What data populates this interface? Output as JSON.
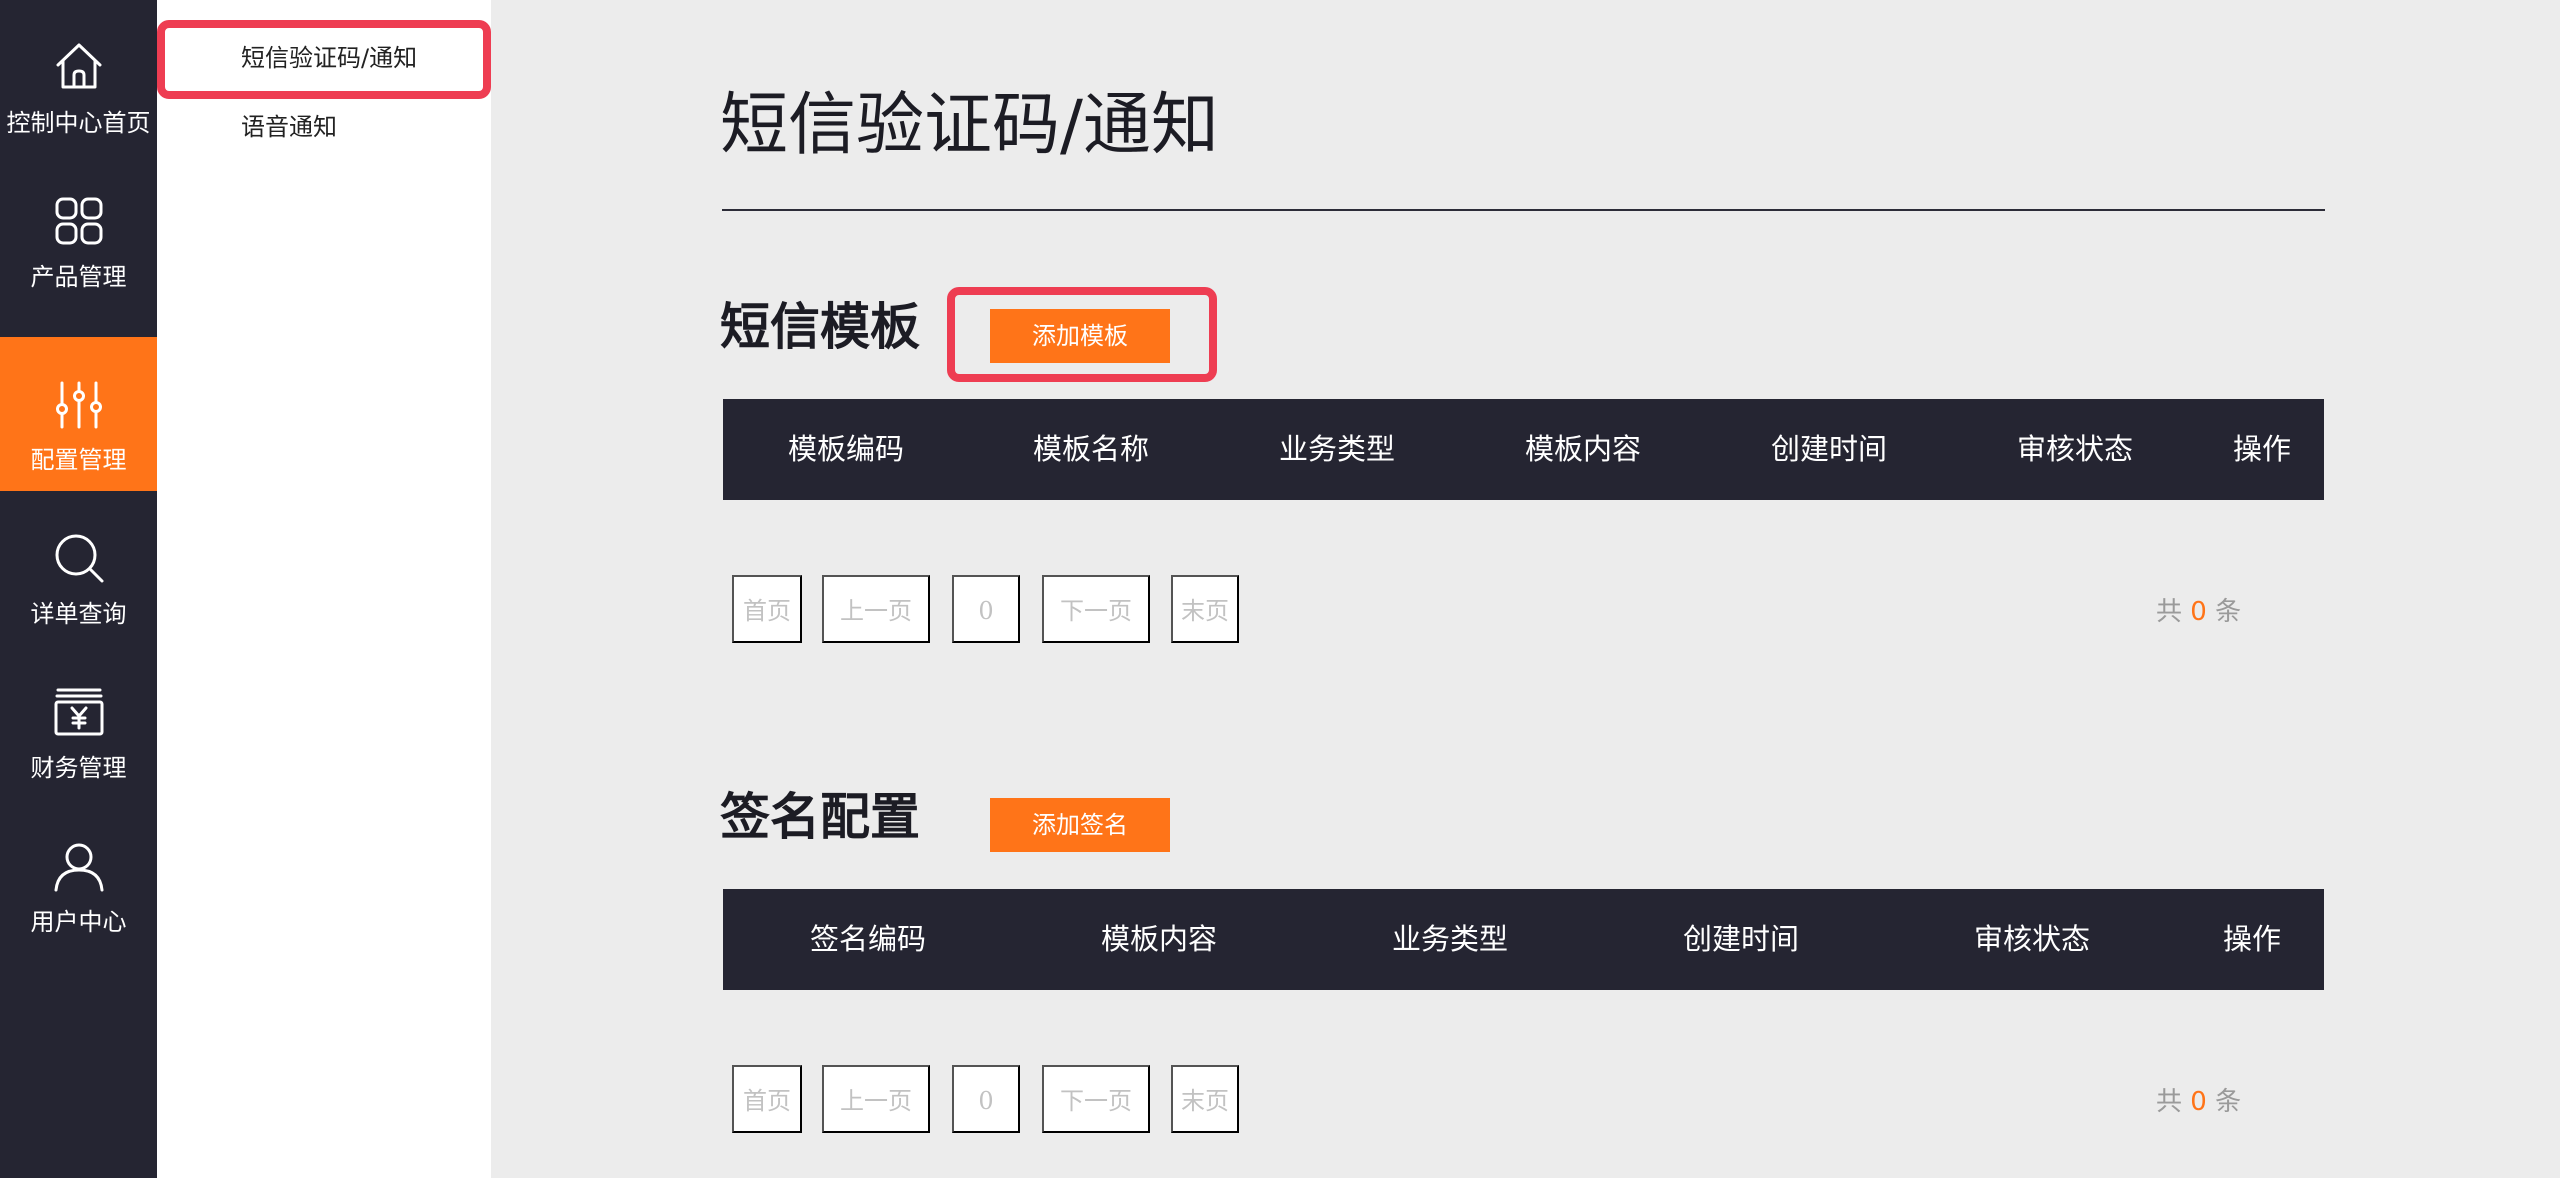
{
  "nav": {
    "items": [
      {
        "label": "控制中心首页",
        "icon": "home-icon"
      },
      {
        "label": "产品管理",
        "icon": "grid-icon"
      },
      {
        "label": "配置管理",
        "icon": "sliders-icon",
        "active": true
      },
      {
        "label": "详单查询",
        "icon": "search-icon"
      },
      {
        "label": "财务管理",
        "icon": "yen-box-icon"
      },
      {
        "label": "用户中心",
        "icon": "user-icon"
      }
    ]
  },
  "submenu": {
    "items": [
      {
        "label": "短信验证码/通知",
        "selected": true
      },
      {
        "label": "语音通知"
      }
    ]
  },
  "main": {
    "title": "短信验证码/通知",
    "sms_template": {
      "title": "短信模板",
      "add_button": "添加模板",
      "columns": [
        "模板编码",
        "模板名称",
        "业务类型",
        "模板内容",
        "创建时间",
        "审核状态",
        "操作"
      ],
      "rows": [],
      "pager": {
        "first": "首页",
        "prev": "上一页",
        "page": "0",
        "next": "下一页",
        "last": "末页"
      },
      "total": {
        "prefix": "共",
        "count": "0",
        "suffix": "条"
      }
    },
    "signature": {
      "title": "签名配置",
      "add_button": "添加签名",
      "columns": [
        "签名编码",
        "模板内容",
        "业务类型",
        "创建时间",
        "审核状态",
        "操作"
      ],
      "rows": [],
      "pager": {
        "first": "首页",
        "prev": "上一页",
        "page": "0",
        "next": "下一页",
        "last": "末页"
      },
      "total": {
        "prefix": "共",
        "count": "0",
        "suffix": "条"
      }
    }
  },
  "colors": {
    "accent": "#ff7418",
    "sidebar": "#252532",
    "highlight": "#ee3d52"
  }
}
